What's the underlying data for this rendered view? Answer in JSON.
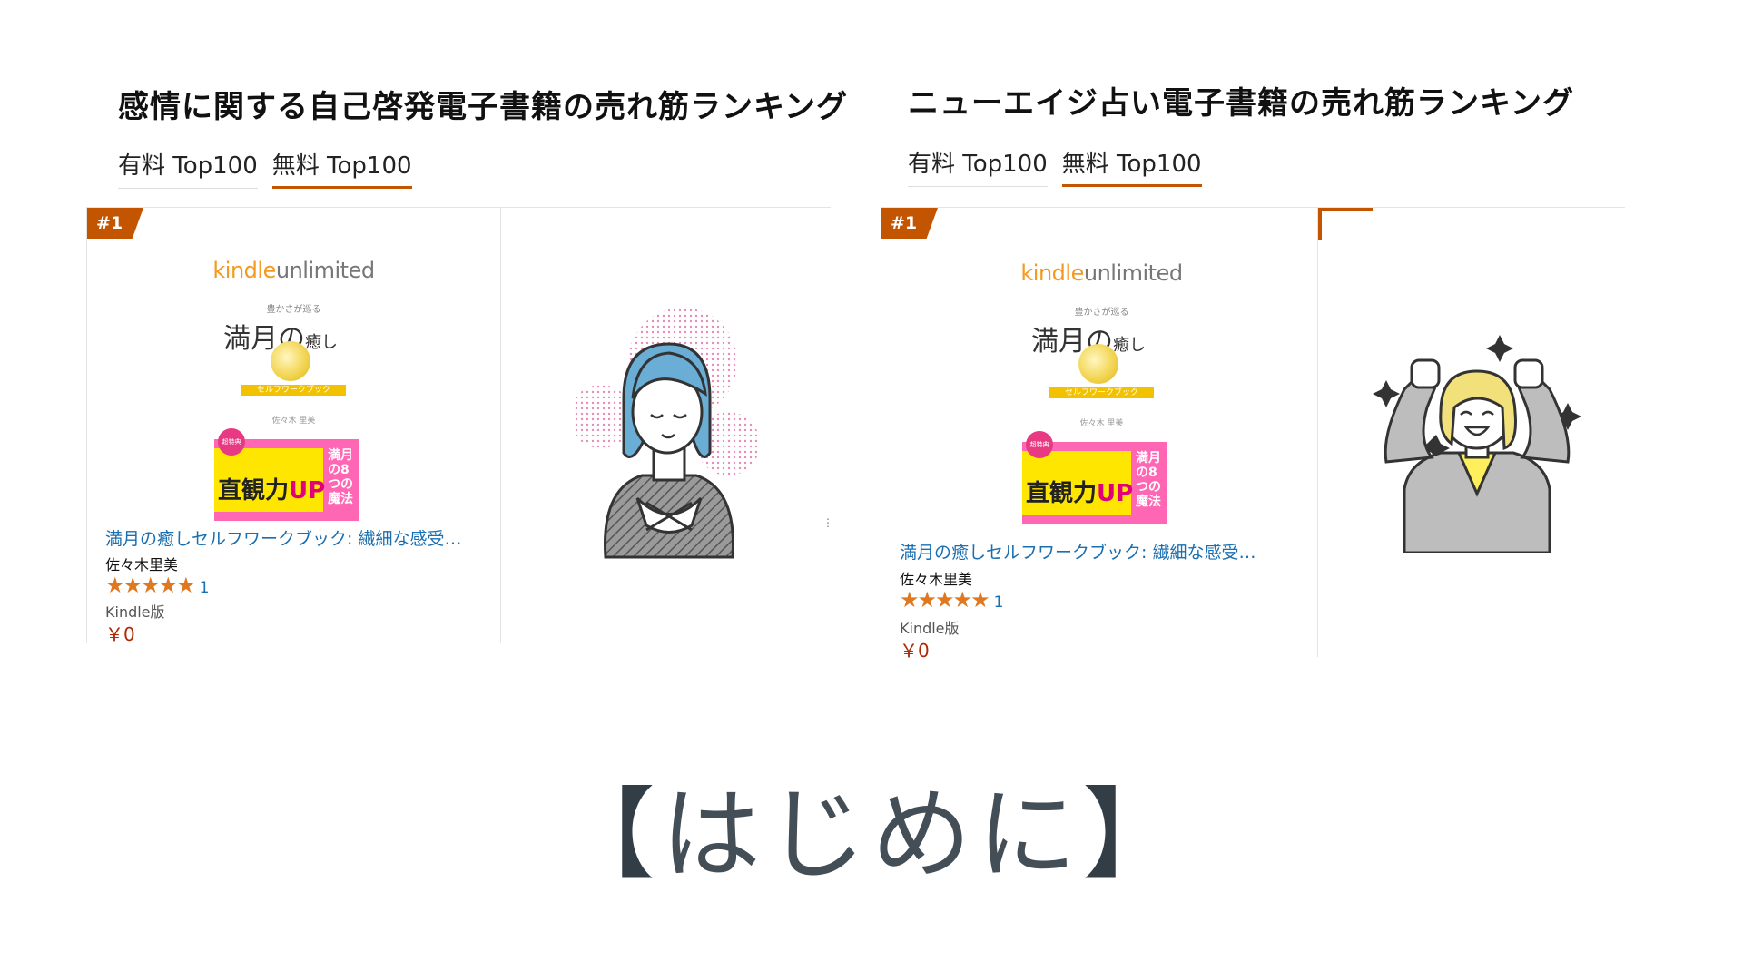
{
  "panels": [
    {
      "title": "感情に関する自己啓発電子書籍の売れ筋ランキング",
      "tabs": [
        "有料 Top100",
        "無料 Top100"
      ],
      "active_tab": 1,
      "card": {
        "rank": "#1",
        "cover": {
          "logo_kindle": "kindle",
          "logo_unlimited": "unlimited",
          "subtitle": "豊かさが巡る",
          "title_main": "満月の",
          "title_tail": "癒し",
          "band": "セルフワークブック",
          "author_small": "佐々木 里美",
          "tag": "超特典",
          "catch": "直観力",
          "catch_up": "UP",
          "side": "満月の8つの魔法"
        },
        "title": "満月の癒しセルフワークブック: 繊細な感受…",
        "author": "佐々木里美",
        "stars": "★★★★★",
        "rating_count": "1",
        "format": "Kindle版",
        "price": "￥0"
      }
    },
    {
      "title": "ニューエイジ占い電子書籍の売れ筋ランキング",
      "tabs": [
        "有料 Top100",
        "無料 Top100"
      ],
      "active_tab": 1,
      "card": {
        "rank": "#1",
        "cover": {
          "logo_kindle": "kindle",
          "logo_unlimited": "unlimited",
          "subtitle": "豊かさが巡る",
          "title_main": "満月の",
          "title_tail": "癒し",
          "band": "セルフワークブック",
          "author_small": "佐々木 里美",
          "tag": "超特典",
          "catch": "直観力",
          "catch_up": "UP",
          "side": "満月の8つの魔法"
        },
        "title": "満月の癒しセルフワークブック: 繊細な感受…",
        "author": "佐々木里美",
        "stars": "★★★★★",
        "rating_count": "1",
        "format": "Kindle版",
        "price": "￥0"
      }
    }
  ],
  "heading": {
    "open": "【",
    "text": "はじめに",
    "close": "】"
  },
  "colors": {
    "badge": "#c45500",
    "link": "#1a6fb0",
    "price": "#b12704",
    "star": "#de7921"
  },
  "icons": [
    "calm-woman-illustration",
    "cheering-woman-illustration"
  ]
}
